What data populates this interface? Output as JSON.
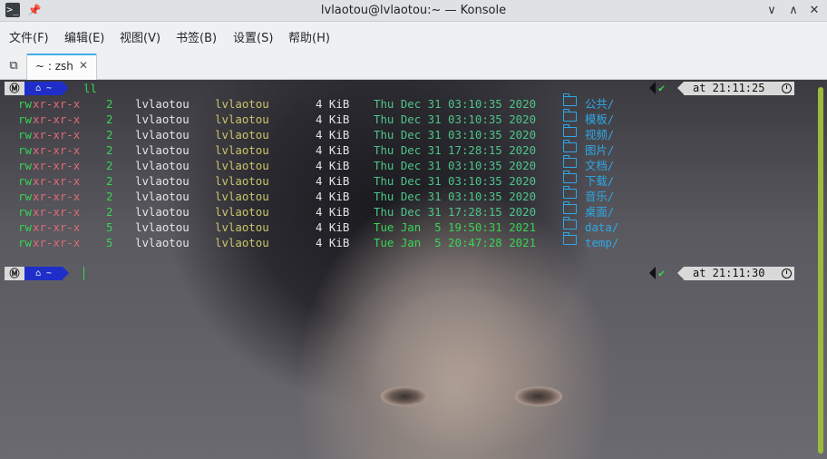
{
  "window": {
    "title": "lvlaotou@lvlaotou:~ — Konsole",
    "app_icon": "terminal-icon",
    "pin_icon": "pin-icon",
    "controls": {
      "minimize": "∨",
      "maximize": "∧",
      "close": "✕"
    }
  },
  "menu": [
    "文件(F)",
    "编辑(E)",
    "视图(V)",
    "书签(B)",
    "设置(S)",
    "帮助(H)"
  ],
  "tabs": {
    "new_tab_icon": "new-tab-icon",
    "active_label": "~ : zsh",
    "close": "✕"
  },
  "prompt": {
    "os_glyph": "Ⓜ",
    "dir_label": "⌂ ~",
    "command": "ll",
    "status_check": "✔",
    "time_1": "at 21:11:25",
    "time_2": "at 21:11:30"
  },
  "listing": [
    {
      "perm_r": "rw",
      "perm_x": "xr-xr-x",
      "links": "2",
      "user": "lvlaotou",
      "group": "lvlaotou",
      "size": "4 KiB",
      "date": "Thu Dec 31 03:10:35 2020",
      "name": "公共/",
      "recent": false
    },
    {
      "perm_r": "rw",
      "perm_x": "xr-xr-x",
      "links": "2",
      "user": "lvlaotou",
      "group": "lvlaotou",
      "size": "4 KiB",
      "date": "Thu Dec 31 03:10:35 2020",
      "name": "模板/",
      "recent": false
    },
    {
      "perm_r": "rw",
      "perm_x": "xr-xr-x",
      "links": "2",
      "user": "lvlaotou",
      "group": "lvlaotou",
      "size": "4 KiB",
      "date": "Thu Dec 31 03:10:35 2020",
      "name": "视频/",
      "recent": false
    },
    {
      "perm_r": "rw",
      "perm_x": "xr-xr-x",
      "links": "2",
      "user": "lvlaotou",
      "group": "lvlaotou",
      "size": "4 KiB",
      "date": "Thu Dec 31 17:28:15 2020",
      "name": "图片/",
      "recent": false
    },
    {
      "perm_r": "rw",
      "perm_x": "xr-xr-x",
      "links": "2",
      "user": "lvlaotou",
      "group": "lvlaotou",
      "size": "4 KiB",
      "date": "Thu Dec 31 03:10:35 2020",
      "name": "文档/",
      "recent": false
    },
    {
      "perm_r": "rw",
      "perm_x": "xr-xr-x",
      "links": "2",
      "user": "lvlaotou",
      "group": "lvlaotou",
      "size": "4 KiB",
      "date": "Thu Dec 31 03:10:35 2020",
      "name": "下载/",
      "recent": false
    },
    {
      "perm_r": "rw",
      "perm_x": "xr-xr-x",
      "links": "2",
      "user": "lvlaotou",
      "group": "lvlaotou",
      "size": "4 KiB",
      "date": "Thu Dec 31 03:10:35 2020",
      "name": "音乐/",
      "recent": false
    },
    {
      "perm_r": "rw",
      "perm_x": "xr-xr-x",
      "links": "2",
      "user": "lvlaotou",
      "group": "lvlaotou",
      "size": "4 KiB",
      "date": "Thu Dec 31 17:28:15 2020",
      "name": "桌面/",
      "recent": false
    },
    {
      "perm_r": "rw",
      "perm_x": "xr-xr-x",
      "links": "5",
      "user": "lvlaotou",
      "group": "lvlaotou",
      "size": "4 KiB",
      "date": "Tue Jan  5 19:50:31 2021",
      "name": "data/",
      "recent": true
    },
    {
      "perm_r": "rw",
      "perm_x": "xr-xr-x",
      "links": "5",
      "user": "lvlaotou",
      "group": "lvlaotou",
      "size": "4 KiB",
      "date": "Tue Jan  5 20:47:28 2021",
      "name": "temp/",
      "recent": true
    }
  ],
  "colors": {
    "accent": "#3daee9",
    "prompt_dir_bg": "#1f2ec8",
    "green": "#39d353",
    "dir_blue": "#2ea8e6",
    "scrollbar": "#9bbb3c"
  }
}
